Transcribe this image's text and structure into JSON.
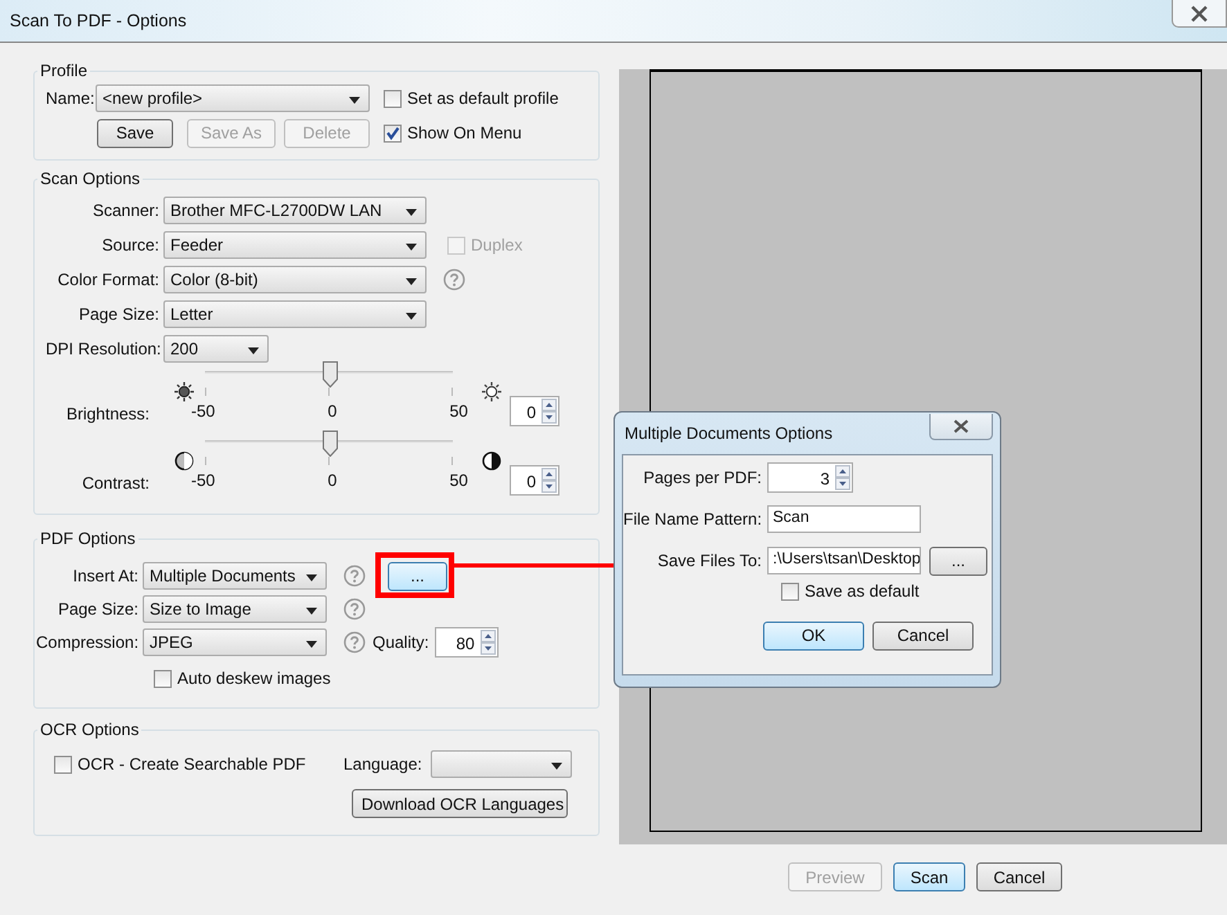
{
  "window": {
    "title": "Scan To PDF - Options"
  },
  "profile": {
    "title": "Profile",
    "name_label": "Name:",
    "name_value": "<new profile>",
    "set_default": {
      "label": "Set as default profile",
      "checked": false
    },
    "buttons": [
      {
        "label": "Save",
        "disabled": false
      },
      {
        "label": "Save As",
        "disabled": true
      },
      {
        "label": "Delete",
        "disabled": true
      }
    ],
    "show_on_menu": {
      "label": "Show On Menu",
      "checked": true
    }
  },
  "scan_options": {
    "title": "Scan Options",
    "fields": [
      {
        "label": "Scanner:",
        "value": "Brother MFC-L2700DW LAN",
        "kind": "wide",
        "help": false
      },
      {
        "label": "Source:",
        "value": "Feeder",
        "kind": "wide",
        "help": false,
        "checkbox": {
          "label": "Duplex",
          "checked": false,
          "disabled": true
        }
      },
      {
        "label": "Color Format:",
        "value": "Color (8-bit)",
        "kind": "wide",
        "help": true
      },
      {
        "label": "Page Size:",
        "value": "Letter",
        "kind": "wide",
        "help": false
      },
      {
        "label": "DPI Resolution:",
        "value": "200",
        "kind": "narrow",
        "help": false
      }
    ],
    "sliders": [
      {
        "label": "Brightness:",
        "kind": "brightness",
        "min_label": "-50",
        "mid_label": "0",
        "max_label": "50",
        "level": 0.5,
        "value": "0"
      },
      {
        "label": "Contrast:",
        "kind": "contrast",
        "min_label": "-50",
        "mid_label": "0",
        "max_label": "50",
        "level": 0.5,
        "value": "0"
      }
    ]
  },
  "pdf_options": {
    "title": "PDF Options",
    "fields": [
      {
        "label": "Insert At:",
        "value": "Multiple Documents",
        "help": true,
        "more_button": {
          "label": "...",
          "highlighted": true
        }
      },
      {
        "label": "Page Size:",
        "value": "Size to Image",
        "help": true
      },
      {
        "label": "Compression:",
        "value": "JPEG",
        "help": true,
        "quality": {
          "label": "Quality:",
          "value": "80"
        }
      }
    ],
    "auto_deskew": {
      "label": "Auto deskew images",
      "checked": false
    }
  },
  "ocr_options": {
    "title": "OCR Options",
    "ocr": {
      "label": "OCR - Create Searchable PDF",
      "checked": false
    },
    "language_label": "Language:",
    "download_button": "Download OCR Languages"
  },
  "footer_buttons": [
    {
      "label": "Preview",
      "disabled": true,
      "default": false
    },
    {
      "label": "Scan",
      "disabled": false,
      "default": true
    },
    {
      "label": "Cancel",
      "disabled": false,
      "default": false
    }
  ],
  "dialog": {
    "title": "Multiple Documents Options",
    "pages_per_pdf": {
      "label": "Pages per PDF:",
      "value": "3"
    },
    "file_name_pattern": {
      "label": "File Name Pattern:",
      "value": "Scan"
    },
    "save_files_to": {
      "label": "Save Files To:",
      "value": ":\\Users\\tsan\\Desktop",
      "browse": "..."
    },
    "save_as_default": {
      "label": "Save as default",
      "checked": false
    },
    "buttons": [
      {
        "label": "OK",
        "default": true
      },
      {
        "label": "Cancel",
        "default": false
      }
    ]
  }
}
